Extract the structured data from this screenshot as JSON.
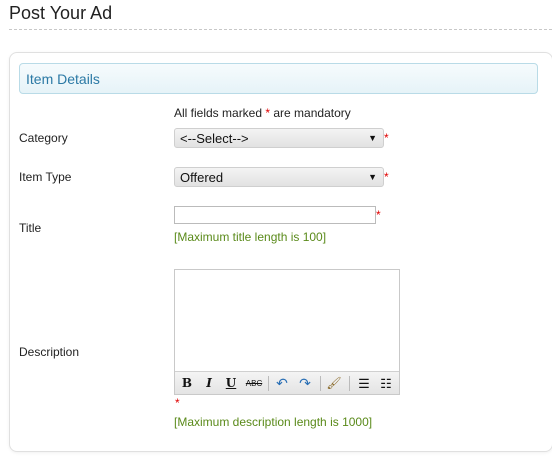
{
  "page": {
    "title": "Post Your Ad"
  },
  "section": {
    "title": "Item Details"
  },
  "mandatory_note": {
    "prefix": "All fields marked ",
    "star": "*",
    "suffix": " are mandatory"
  },
  "fields": {
    "category": {
      "label": "Category",
      "selected": "<--Select-->",
      "required_mark": "*"
    },
    "item_type": {
      "label": "Item Type",
      "selected": "Offered",
      "required_mark": "*"
    },
    "title": {
      "label": "Title",
      "value": "",
      "required_mark": "*",
      "hint": "[Maximum title length is 100]"
    },
    "description": {
      "label": "Description",
      "value": "",
      "required_mark": "*",
      "hint": "[Maximum description length is 1000]"
    }
  },
  "editor_toolbar": {
    "bold": "B",
    "italic": "I",
    "underline": "U",
    "strikethrough": "ABC",
    "undo": "↶",
    "redo": "↷",
    "clear_format": "🖌",
    "bullet_list": "☰",
    "numbered_list": "☷"
  },
  "colors": {
    "accent": "#2b79a5",
    "required": "#e00000",
    "hint": "#5a8a1a"
  }
}
